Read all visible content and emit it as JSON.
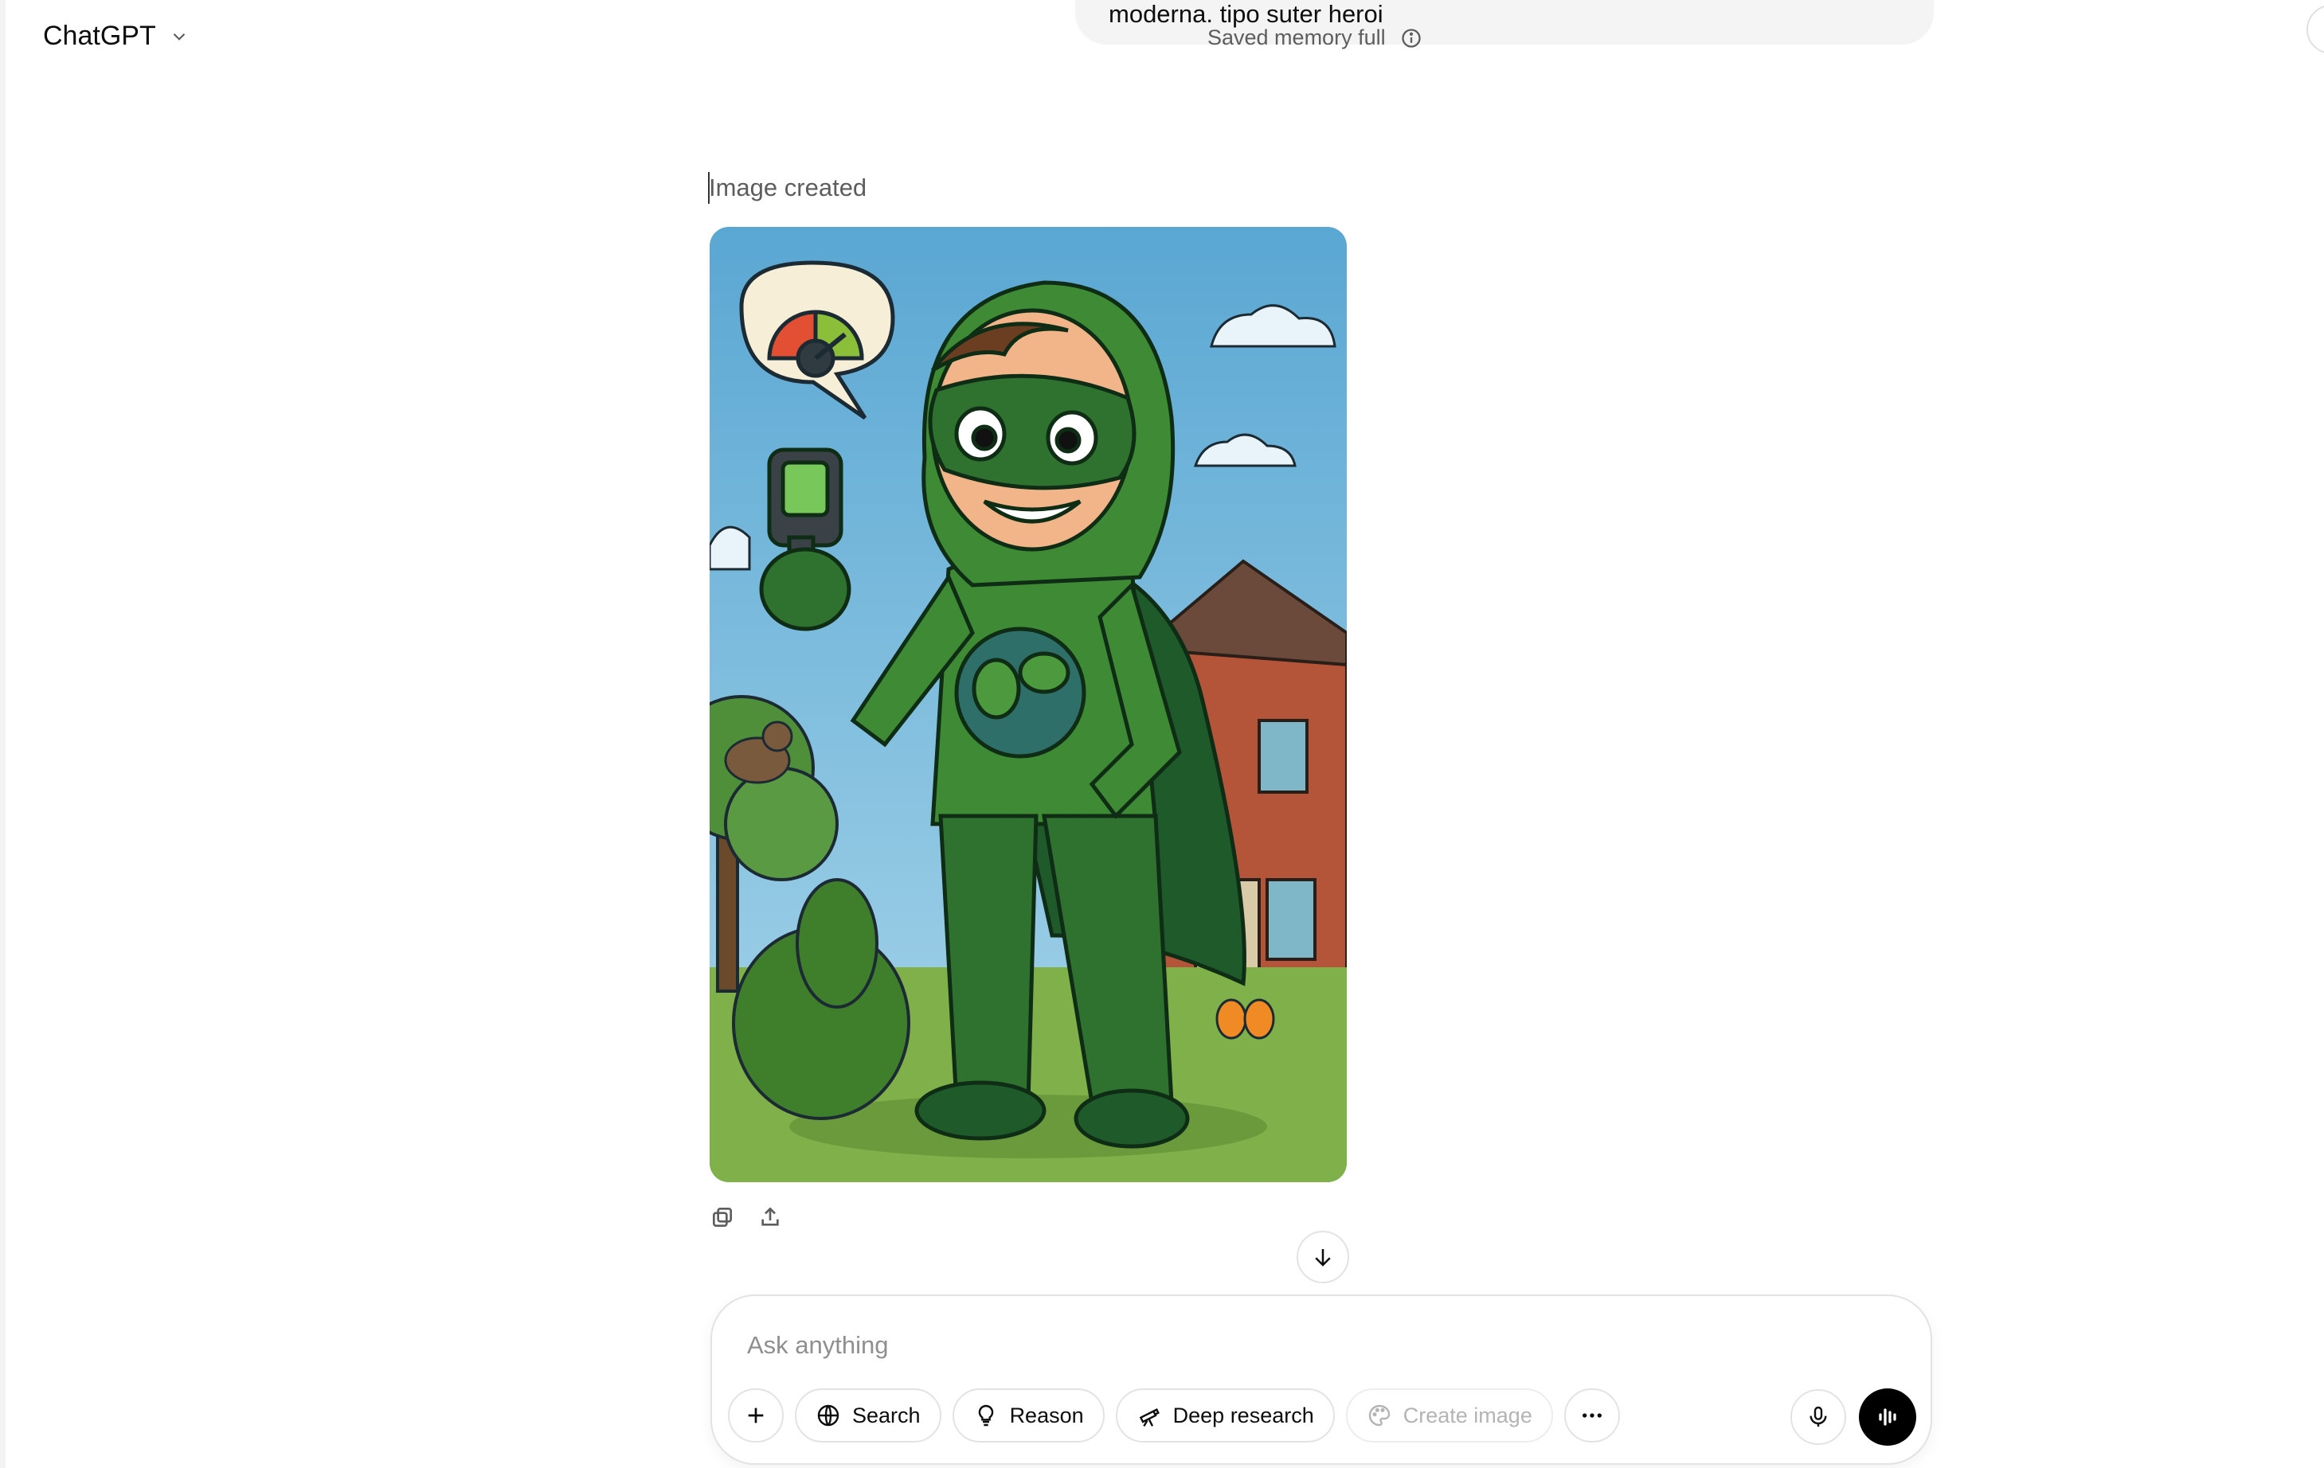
{
  "header": {
    "model_name": "ChatGPT"
  },
  "user_message": {
    "text_fragment": "moderna. tipo suter heroi"
  },
  "memory_notice": {
    "label": "Saved memory full"
  },
  "assistant": {
    "image_label": "Image created"
  },
  "composer": {
    "placeholder": "Ask anything",
    "tools": {
      "search": "Search",
      "reason": "Reason",
      "deep_research": "Deep research",
      "create_image": "Create image"
    }
  },
  "colors": {
    "accent": "#000000",
    "muted_text": "#5d5d5d",
    "border": "#e3e3e3"
  }
}
